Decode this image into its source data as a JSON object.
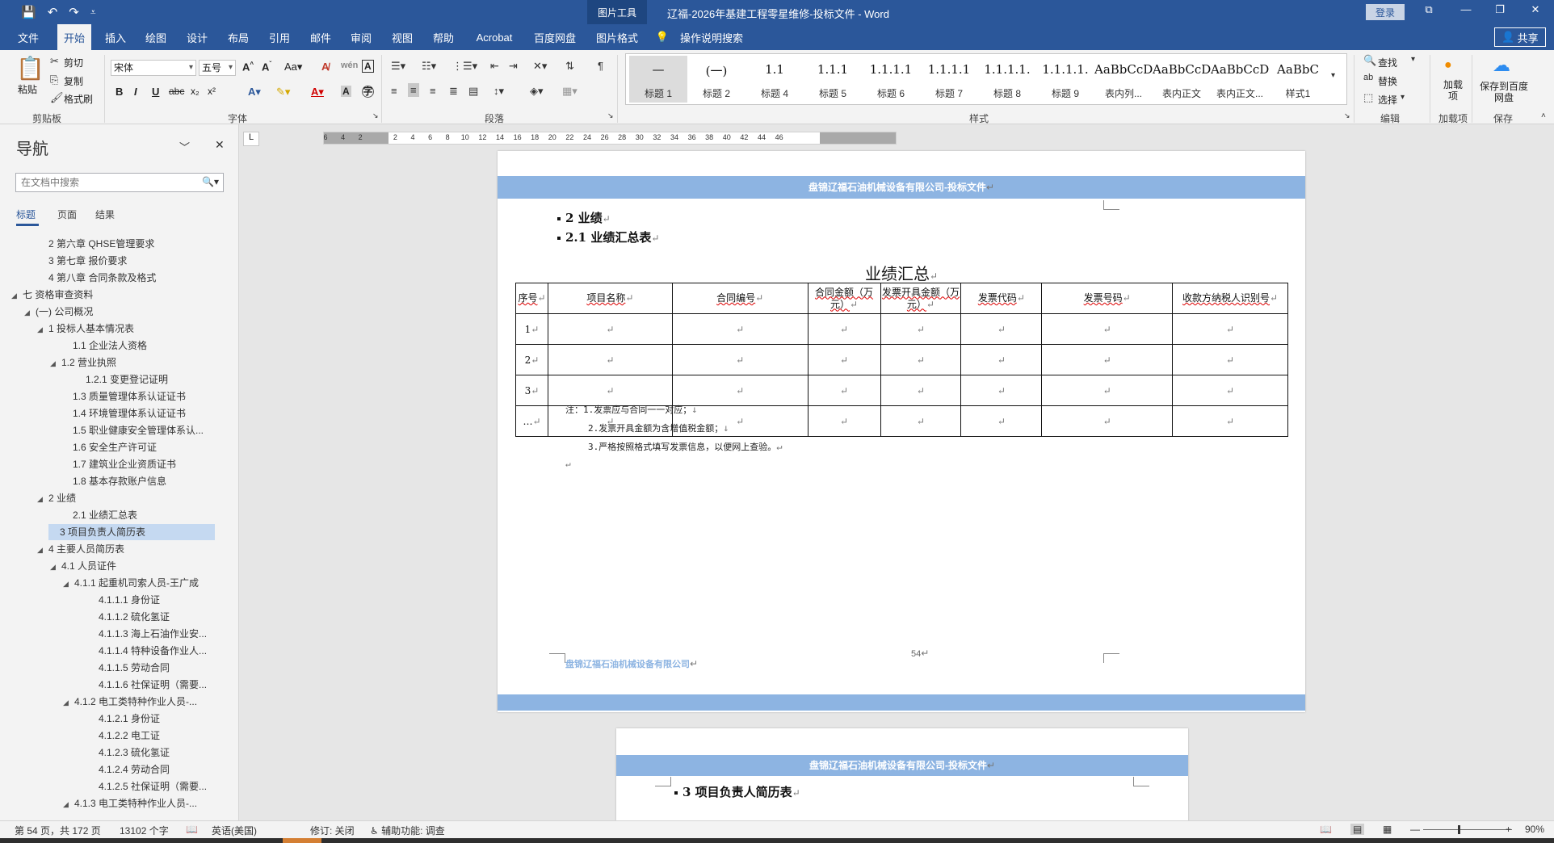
{
  "titlebar": {
    "qat_save": "💾",
    "qat_undo": "↶",
    "qat_redo": "↷",
    "qat_more": "⩡",
    "context_tool": "图片工具",
    "doc_title": "辽福-2026年基建工程零星维修-投标文件  -  Word",
    "login": "登录",
    "win_ribbon_opts": "⧉",
    "win_min": "—",
    "win_max": "❐",
    "win_close": "✕"
  },
  "tabs": {
    "file": "文件",
    "home": "开始",
    "insert": "插入",
    "draw": "绘图",
    "design": "设计",
    "layout": "布局",
    "references": "引用",
    "mailings": "邮件",
    "review": "审阅",
    "view": "视图",
    "help": "帮助",
    "acrobat": "Acrobat",
    "baidu": "百度网盘",
    "picture_format": "图片格式",
    "tell_me": "操作说明搜索",
    "share": "共享"
  },
  "ribbon": {
    "clipboard": {
      "paste": "粘贴",
      "cut": "剪切",
      "copy": "复制",
      "format_painter": "格式刷",
      "label": "剪贴板"
    },
    "font": {
      "name": "宋体",
      "size": "五号",
      "label": "字体"
    },
    "paragraph": {
      "label": "段落"
    },
    "styles": {
      "label": "样式",
      "items": [
        {
          "sample": "—",
          "name": "标题 1"
        },
        {
          "sample": "(一)",
          "name": "标题 2"
        },
        {
          "sample": "1.1",
          "name": "标题 4"
        },
        {
          "sample": "1.1.1",
          "name": "标题 5"
        },
        {
          "sample": "1.1.1.1",
          "name": "标题 6"
        },
        {
          "sample": "1.1.1.1",
          "name": "标题 7"
        },
        {
          "sample": "1.1.1.1.",
          "name": "标题 8"
        },
        {
          "sample": "1.1.1.1.",
          "name": "标题 9"
        },
        {
          "sample": "AaBbCcD",
          "name": "表内列..."
        },
        {
          "sample": "AaBbCcDdI",
          "name": "表内正文"
        },
        {
          "sample": "AaBbCcDc",
          "name": "表内正文..."
        },
        {
          "sample": "AaBbC",
          "name": "样式1"
        }
      ]
    },
    "editing": {
      "find": "查找",
      "replace": "替换",
      "select": "选择",
      "label": "编辑"
    },
    "addins": {
      "btn": "加载项",
      "label": "加载项"
    },
    "save": {
      "btn": "保存到百度网盘",
      "label": "保存"
    }
  },
  "nav": {
    "title": "导航",
    "search_placeholder": "在文档中搜索",
    "tabs": [
      "标题",
      "页面",
      "结果"
    ],
    "items": [
      {
        "text": "2 第六章  QHSE管理要求",
        "indent": 58,
        "tri": ""
      },
      {
        "text": "3 第七章  报价要求",
        "indent": 58,
        "tri": ""
      },
      {
        "text": "4 第八章  合同条款及格式",
        "indent": 58,
        "tri": ""
      },
      {
        "text": "七 资格审查资料",
        "indent": 26,
        "tri": "◢"
      },
      {
        "text": "(一) 公司概况",
        "indent": 42,
        "tri": "◢"
      },
      {
        "text": "1 投标人基本情况表",
        "indent": 58,
        "tri": "◢"
      },
      {
        "text": "1.1 企业法人资格",
        "indent": 88,
        "tri": ""
      },
      {
        "text": "1.2 营业执照",
        "indent": 74,
        "tri": "◢"
      },
      {
        "text": "1.2.1 变更登记证明",
        "indent": 104,
        "tri": ""
      },
      {
        "text": "1.3 质量管理体系认证证书",
        "indent": 88,
        "tri": ""
      },
      {
        "text": "1.4 环境管理体系认证证书",
        "indent": 88,
        "tri": ""
      },
      {
        "text": "1.5 职业健康安全管理体系认...",
        "indent": 88,
        "tri": ""
      },
      {
        "text": "1.6 安全生产许可证",
        "indent": 88,
        "tri": ""
      },
      {
        "text": "1.7 建筑业企业资质证书",
        "indent": 88,
        "tri": ""
      },
      {
        "text": "1.8 基本存款账户信息",
        "indent": 88,
        "tri": ""
      },
      {
        "text": "2 业绩",
        "indent": 58,
        "tri": "◢"
      },
      {
        "text": "2.1 业绩汇总表",
        "indent": 88,
        "tri": ""
      },
      {
        "text": "3 项目负责人简历表",
        "indent": 72,
        "tri": "",
        "selected": true
      },
      {
        "text": "4 主要人员简历表",
        "indent": 58,
        "tri": "◢"
      },
      {
        "text": "4.1 人员证件",
        "indent": 74,
        "tri": "◢"
      },
      {
        "text": "4.1.1 起重机司索人员-王广成",
        "indent": 90,
        "tri": "◢"
      },
      {
        "text": "4.1.1.1 身份证",
        "indent": 120,
        "tri": ""
      },
      {
        "text": "4.1.1.2 硫化氢证",
        "indent": 120,
        "tri": ""
      },
      {
        "text": "4.1.1.3 海上石油作业安...",
        "indent": 120,
        "tri": ""
      },
      {
        "text": "4.1.1.4 特种设备作业人...",
        "indent": 120,
        "tri": ""
      },
      {
        "text": "4.1.1.5 劳动合同",
        "indent": 120,
        "tri": ""
      },
      {
        "text": "4.1.1.6 社保证明（需要...",
        "indent": 120,
        "tri": ""
      },
      {
        "text": "4.1.2 电工类特种作业人员-...",
        "indent": 90,
        "tri": "◢"
      },
      {
        "text": "4.1.2.1 身份证",
        "indent": 120,
        "tri": ""
      },
      {
        "text": "4.1.2.2 电工证",
        "indent": 120,
        "tri": ""
      },
      {
        "text": "4.1.2.3 硫化氢证",
        "indent": 120,
        "tri": ""
      },
      {
        "text": "4.1.2.4 劳动合同",
        "indent": 120,
        "tri": ""
      },
      {
        "text": "4.1.2.5 社保证明（需要...",
        "indent": 120,
        "tri": ""
      },
      {
        "text": "4.1.3 电工类特种作业人员-...",
        "indent": 90,
        "tri": "◢"
      }
    ]
  },
  "ruler": {
    "corner": "L",
    "labels": [
      "6",
      "4",
      "2",
      "",
      "2",
      "4",
      "6",
      "8",
      "10",
      "12",
      "14",
      "16",
      "18",
      "20",
      "22",
      "24",
      "26",
      "28",
      "30",
      "32",
      "34",
      "36",
      "38",
      "40",
      "42",
      "44",
      "46"
    ]
  },
  "page1": {
    "header": "盘锦辽福石油机械设备有限公司-投标文件",
    "heading2": "2   业绩",
    "heading21": "2.1    业绩汇总表",
    "caption": "业绩汇总",
    "table": {
      "headers": [
        "序号",
        "项目名称",
        "合同编号",
        "合同金额（万元）",
        "发票开具金额（万元）",
        "发票代码",
        "发票号码",
        "收款方纳税人识别号"
      ],
      "rows": [
        "1",
        "2",
        "3",
        "…"
      ]
    },
    "notes": [
      "注：1.发票应与合同一一对应；",
      "2.发票开具金额为含增值税金额；",
      "3.严格按照格式填写发票信息，以便网上查验。"
    ],
    "footer": "盘锦辽福石油机械设备有限公司",
    "page_number": "54"
  },
  "page2": {
    "header": "盘锦辽福石油机械设备有限公司-投标文件",
    "heading": "3   项目负责人简历表"
  },
  "status": {
    "page": "第 54 页，共 172 页",
    "words": "13102 个字",
    "lang": "英语(美国)",
    "track": "修订: 关闭",
    "accessibility": "辅助功能: 调查",
    "zoom": "90%"
  },
  "colors": {
    "accent": "#2b579a",
    "header_band": "#8db4e2",
    "nav_selected": "#c5d9f1"
  }
}
